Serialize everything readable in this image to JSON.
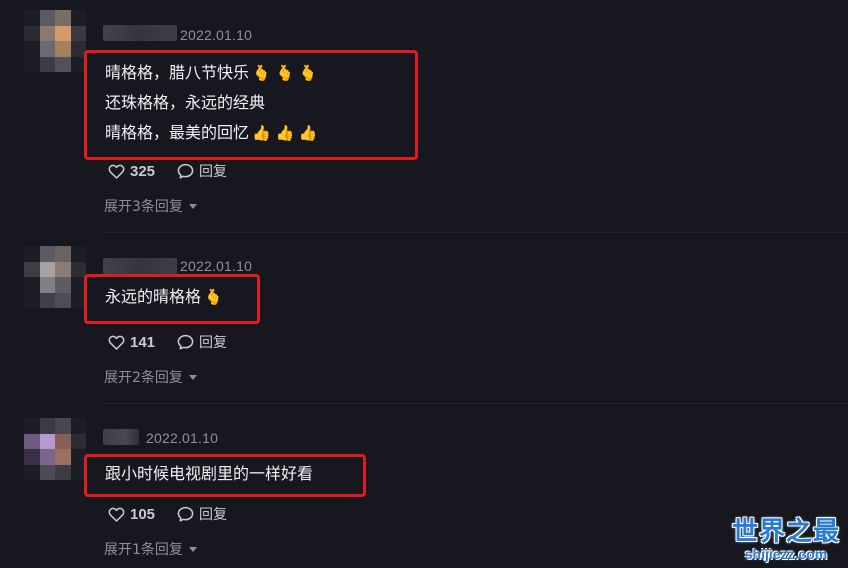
{
  "comments": [
    {
      "date": "2022.01.10",
      "lines": [
        {
          "text": "晴格格，腊八节快乐",
          "emoji": "🫰 🫰 🫰"
        },
        {
          "text": "还珠格格，永远的经典",
          "emoji": ""
        },
        {
          "text": "晴格格，最美的回忆",
          "emoji": "👍 👍 👍"
        }
      ],
      "likes": "325",
      "reply_label": "回复",
      "expand_label": "展开3条回复"
    },
    {
      "date": "2022.01.10",
      "lines": [
        {
          "text": "永远的晴格格",
          "emoji": "🫰"
        }
      ],
      "likes": "141",
      "reply_label": "回复",
      "expand_label": "展开2条回复"
    },
    {
      "date": "2022.01.10",
      "lines": [
        {
          "text": "跟小时候电视剧里的一样好看",
          "emoji": ""
        }
      ],
      "likes": "105",
      "reply_label": "回复",
      "expand_label": "展开1条回复"
    }
  ],
  "watermark": {
    "title": "世界之最",
    "subtitle": "shijiezz.com"
  },
  "colors": {
    "background": "#17181f",
    "highlight_border": "#e01b22",
    "meta_text": "#8e8f99",
    "watermark_blue": "#2a7bd8"
  },
  "icons": {
    "like": "heart-outline-icon",
    "reply": "speech-bubble-icon",
    "expand": "caret-down-icon"
  }
}
